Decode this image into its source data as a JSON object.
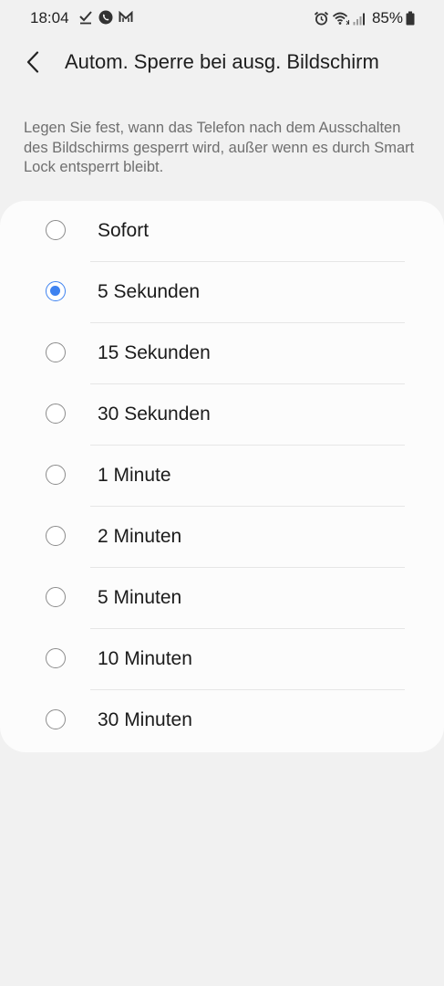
{
  "status_bar": {
    "time": "18:04",
    "battery": "85%",
    "left_icons": [
      "check-icon",
      "phone-call-icon",
      "mail-m-icon"
    ],
    "right_icons": [
      "alarm-icon",
      "wifi-icon",
      "signal-icon",
      "battery-icon"
    ]
  },
  "header": {
    "back_icon": "chevron-left-icon",
    "title": "Autom. Sperre bei ausg. Bildschirm"
  },
  "description": "Legen Sie fest, wann das Telefon nach dem Ausschalten des Bildschirms gesperrt wird, außer wenn es durch Smart Lock entsperrt bleibt.",
  "options": [
    {
      "label": "Sofort",
      "selected": false
    },
    {
      "label": "5 Sekunden",
      "selected": true
    },
    {
      "label": "15 Sekunden",
      "selected": false
    },
    {
      "label": "30 Sekunden",
      "selected": false
    },
    {
      "label": "1 Minute",
      "selected": false
    },
    {
      "label": "2 Minuten",
      "selected": false
    },
    {
      "label": "5 Minuten",
      "selected": false
    },
    {
      "label": "10 Minuten",
      "selected": false
    },
    {
      "label": "30 Minuten",
      "selected": false
    }
  ],
  "colors": {
    "accent": "#3e82f0",
    "background": "#f1f1f1",
    "card": "#fcfcfc"
  }
}
